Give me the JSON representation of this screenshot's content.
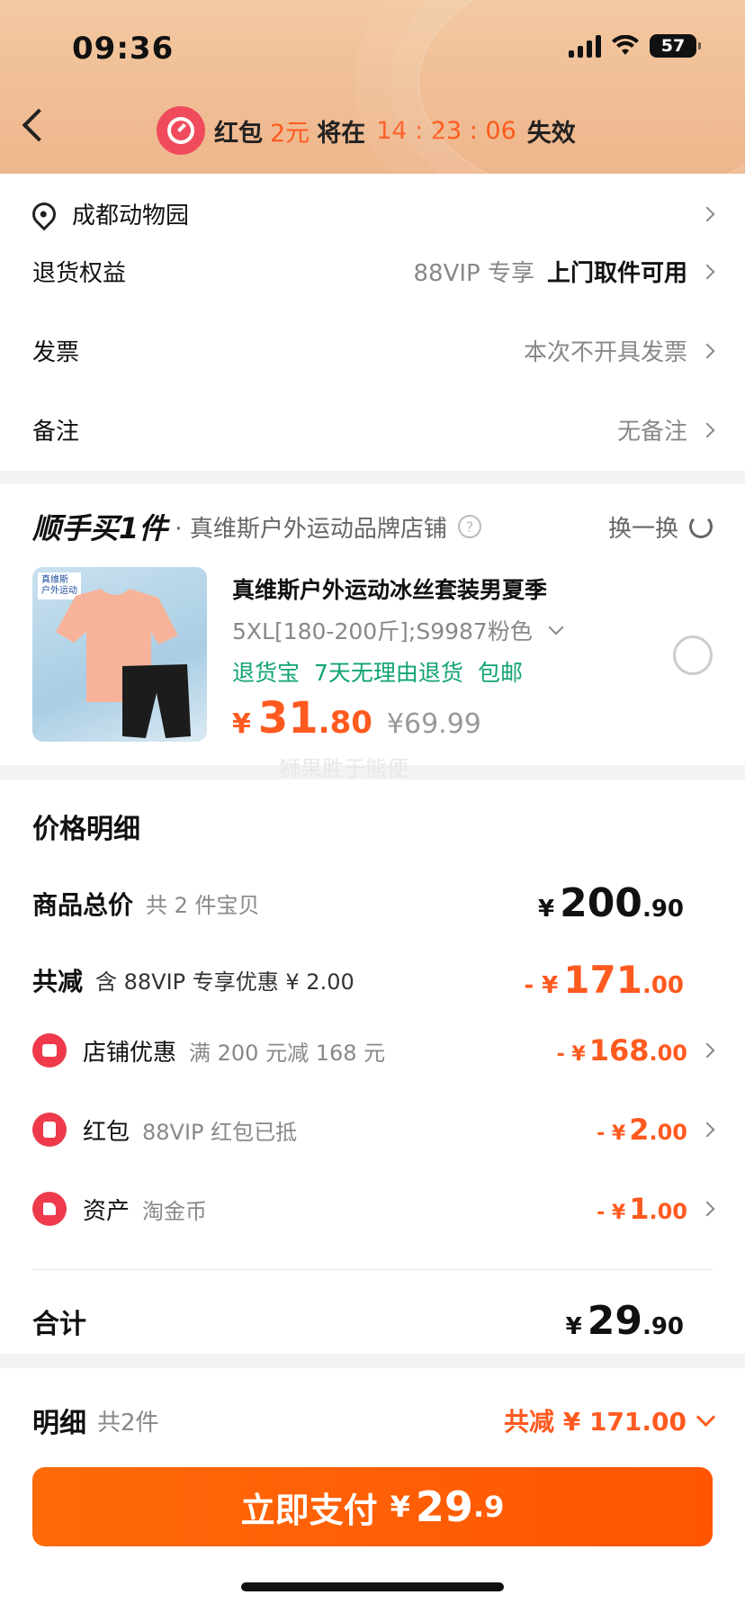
{
  "status_bar": {
    "time": "09:36",
    "battery": "57"
  },
  "banner": {
    "prefix": "红包",
    "amount": "2元",
    "mid": "将在",
    "countdown": "14 : 23 : 06",
    "suffix": "失效"
  },
  "address": {
    "text": "成都动物园"
  },
  "rows": {
    "return": {
      "label": "退货权益",
      "note": "88VIP 专享",
      "value": "上门取件可用"
    },
    "invoice": {
      "label": "发票",
      "value": "本次不开具发票"
    },
    "remark": {
      "label": "备注",
      "value": "无备注"
    }
  },
  "addon": {
    "title_part1": "顺手买",
    "title_part2": "1件",
    "store": "· 真维斯户外运动品牌店铺",
    "swap": "换一换",
    "product": {
      "thumb_brand": "真维斯",
      "thumb_sub": "户外运动",
      "name": "真维斯户外运动冰丝套装男夏季",
      "sku": "5XL[180-200斤];S9987粉色",
      "tags": [
        "退货宝",
        "7天无理由退货",
        "包邮"
      ],
      "price_symbol": "¥",
      "price_int": "31",
      "price_dec": ".80",
      "orig_price": "¥69.99"
    },
    "watermark": "狮果胜于熊便"
  },
  "price_detail": {
    "title": "价格明细",
    "total": {
      "label": "商品总价",
      "sub": "共 2 件宝贝",
      "symbol": "¥",
      "int": "200",
      "dec": ".90"
    },
    "discount": {
      "label": "共减",
      "sub": "含 88VIP 专享优惠 ¥ 2.00",
      "prefix": "- ¥",
      "int": "171",
      "dec": ".00"
    },
    "store_coupon": {
      "label": "店铺优惠",
      "sub": "满 200 元减 168 元",
      "prefix": "- ¥",
      "int": "168",
      "dec": ".00"
    },
    "red_packet": {
      "label": "红包",
      "sub": "88VIP 红包已抵",
      "prefix": "- ¥",
      "int": "2",
      "dec": ".00"
    },
    "asset": {
      "label": "资产",
      "sub": "淘金币",
      "prefix": "- ¥",
      "int": "1",
      "dec": ".00"
    },
    "sum": {
      "label": "合计",
      "symbol": "¥",
      "int": "29",
      "dec": ".90"
    }
  },
  "footer": {
    "label": "明细",
    "count": "共2件",
    "reduce": "共减 ¥ 171.00",
    "pay_label": "立即支付",
    "pay_symbol": "¥",
    "pay_int": "29",
    "pay_dec": ".9"
  },
  "colors": {
    "accent": "#ff5a1f",
    "green": "#11a372",
    "red": "#ee3a4a"
  }
}
